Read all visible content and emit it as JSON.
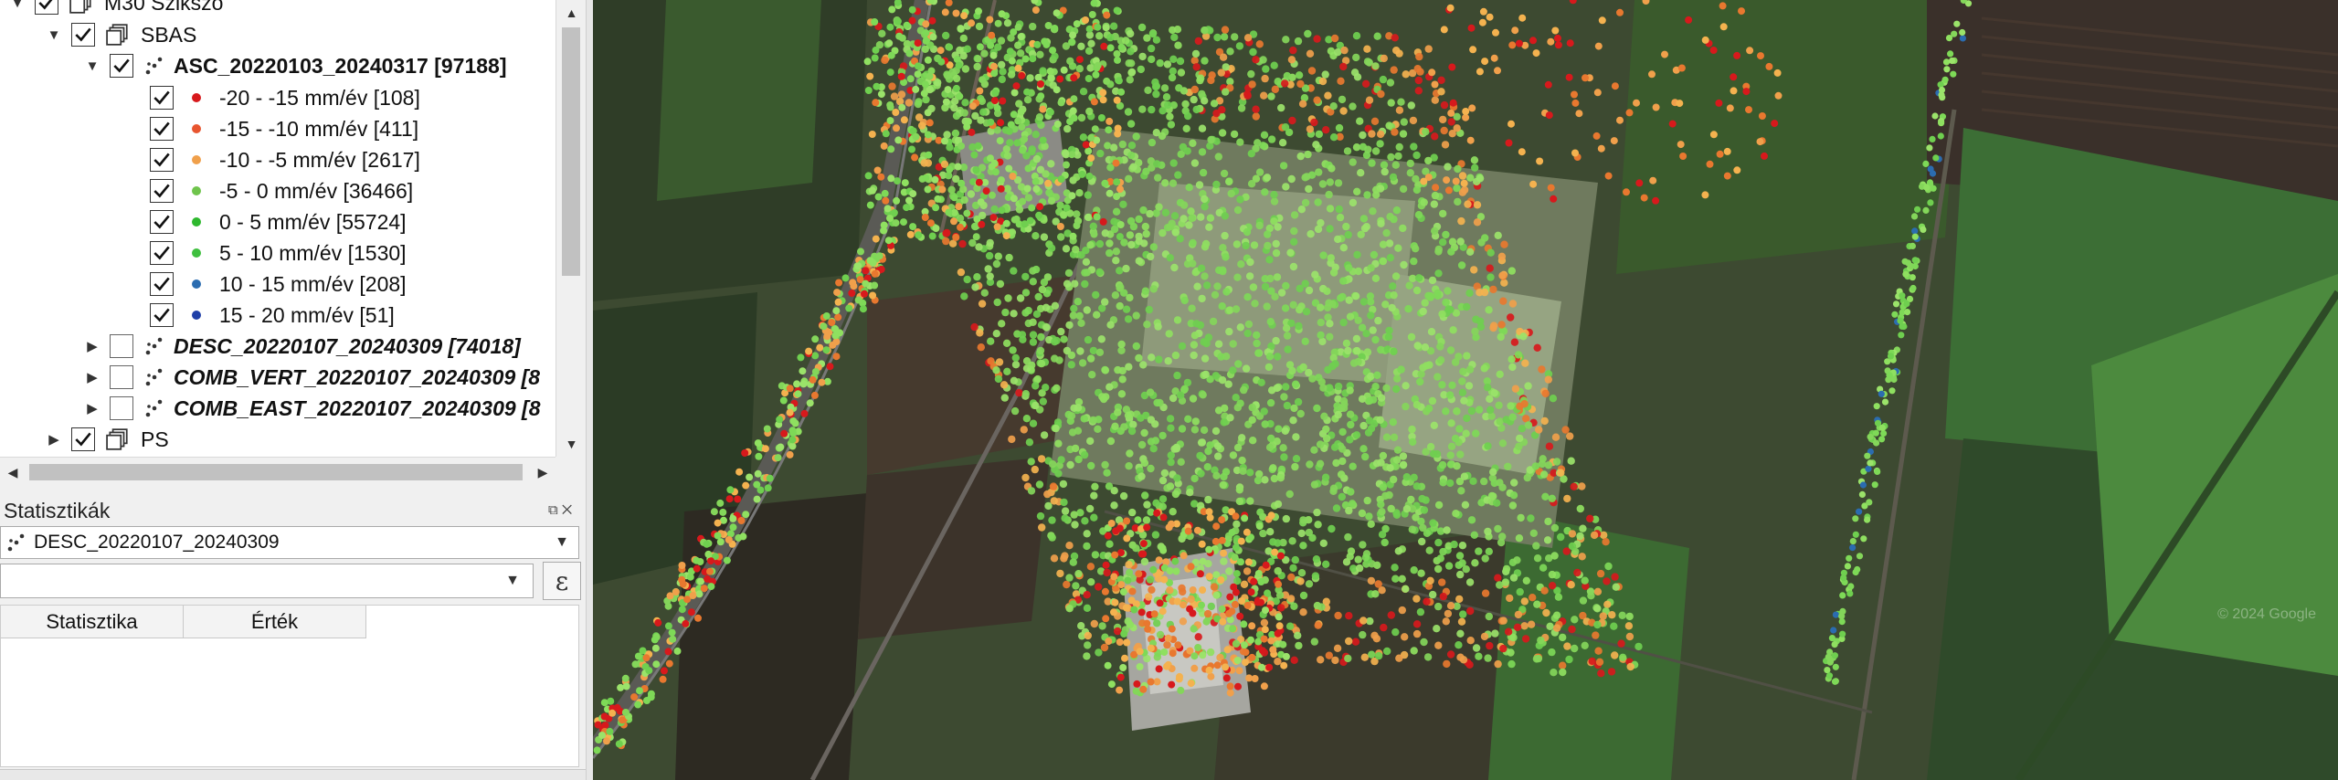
{
  "tree": {
    "root": {
      "label": "M30 Szikszó"
    },
    "group": {
      "label": "SBAS"
    },
    "asc_layer": {
      "label": "ASC_20220103_20240317 [97188]"
    },
    "classes": [
      {
        "label": "-20 - -15 mm/év [108]",
        "color": "#d7191c"
      },
      {
        "label": "-15 - -10 mm/év [411]",
        "color": "#e8552f"
      },
      {
        "label": "-10 - -5 mm/év [2617]",
        "color": "#f0a04b"
      },
      {
        "label": "-5 - 0 mm/év [36466]",
        "color": "#6fc44c"
      },
      {
        "label": "0 - 5 mm/év [55724]",
        "color": "#2eb82e"
      },
      {
        "label": "5 - 10 mm/év [1530]",
        "color": "#3fbf3f"
      },
      {
        "label": "10 - 15 mm/év [208]",
        "color": "#2b6cb0"
      },
      {
        "label": "15 - 20 mm/év [51]",
        "color": "#1f3fa8"
      }
    ],
    "desc_layer": {
      "label": "DESC_20220107_20240309 [74018]"
    },
    "comb_vert": {
      "label": "COMB_VERT_20220107_20240309 [8"
    },
    "comb_east": {
      "label": "COMB_EAST_20220107_20240309 [8"
    },
    "ps": {
      "label": "PS"
    }
  },
  "statistics": {
    "title": "Statisztikák",
    "layer": "DESC_20220107_20240309",
    "field": "",
    "expr_icon": "ε",
    "columns": [
      "Statisztika",
      "Érték"
    ]
  },
  "map": {
    "watermark": "© 2024 Google"
  }
}
